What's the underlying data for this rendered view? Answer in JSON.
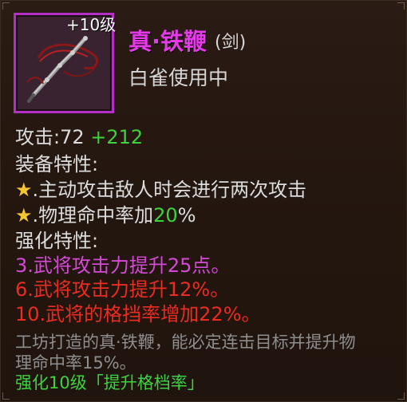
{
  "item": {
    "level": "+10级",
    "name": "真·铁鞭",
    "type": "(剑)",
    "owner": "白雀使用中"
  },
  "stats": {
    "attack_label": "攻击:",
    "attack_base": "72",
    "attack_bonus": "+212"
  },
  "equip_traits": {
    "header": "装备特性:",
    "star": "★",
    "items": [
      {
        "text": ".主动攻击敌人时会进行两次攻击"
      },
      {
        "text_before": ".物理命中率加",
        "highlight": "20",
        "text_after": "%"
      }
    ]
  },
  "refine_traits": {
    "header": "强化特性:",
    "items": [
      "3.武将攻击力提升25点。",
      "6.武将攻击力提升12%。",
      "10.武将的格挡率增加22%。"
    ]
  },
  "description": {
    "line1": "工坊打造的真·铁鞭，能必定连击目标并提升物",
    "line2": "理命中率15%。"
  },
  "footer": "强化10级「提升格档率」",
  "colors": {
    "frame": "#b42fc6",
    "name": "#e43ae8",
    "bonus_green": "#3fd23f",
    "refine_purple": "#d44ad6",
    "refine_red": "#ea2c21",
    "star": "#f4c531"
  }
}
